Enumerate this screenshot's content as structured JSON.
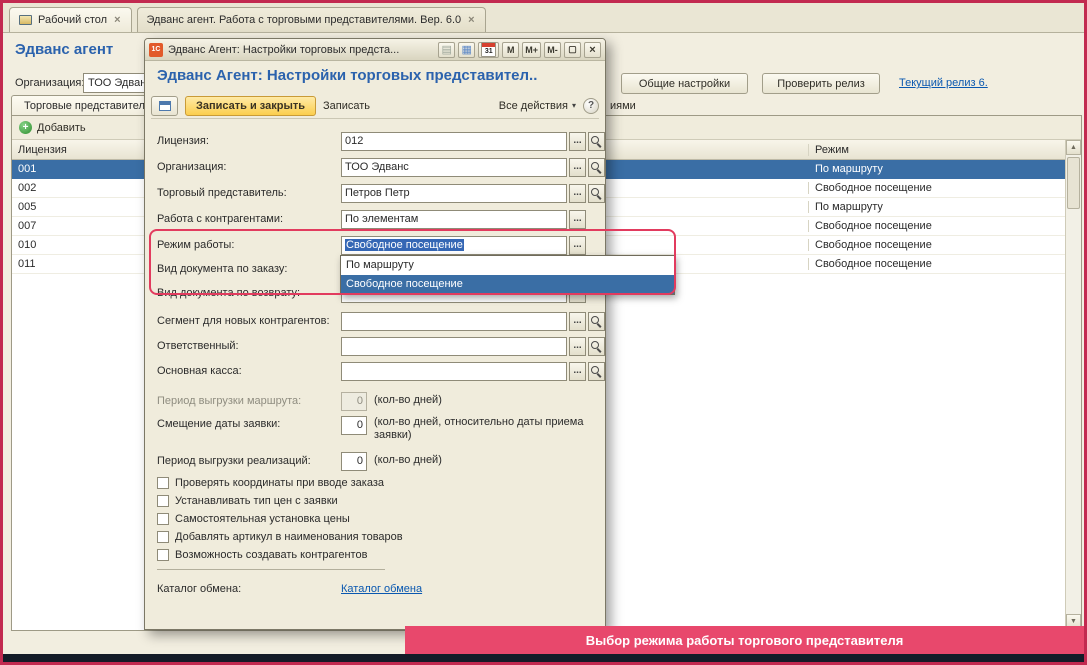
{
  "ui": {
    "close": "×",
    "ellipsis": "...",
    "arrow_down": "▾",
    "scroll_up": "▲",
    "scroll_down": "▼",
    "plus": "+",
    "grid_glyph": "▦",
    "panel_glyph": "▤",
    "maximize_glyph": "▢"
  },
  "colors": {
    "accent_red": "#e23b5e",
    "selection_blue": "#3a6ea5",
    "link_blue": "#0a58b0",
    "banner_pink": "#e8486c"
  },
  "window_tabs": [
    {
      "label": "Рабочий стол"
    },
    {
      "label": "Эдванс агент. Работа с торговыми представителями. Вер. 6.0"
    }
  ],
  "main": {
    "title": "Эдванс агент",
    "org": {
      "label": "Организация:",
      "value": "ТОО Эдванс"
    },
    "actions": {
      "common_settings": "Общие настройки",
      "check_release": "Проверить релиз",
      "current_release": "Текущий релиз 6."
    },
    "tab_reps": "Торговые представители",
    "tab_fragment": "иями",
    "add_button": "Добавить",
    "table": {
      "columns": [
        "Лицензия",
        "Режим"
      ],
      "selected_row": 0,
      "rows": [
        {
          "license": "001",
          "mode": "По маршруту"
        },
        {
          "license": "002",
          "mode": "Свободное посещение"
        },
        {
          "license": "005",
          "mode": "По маршруту"
        },
        {
          "license": "007",
          "mode": "Свободное посещение"
        },
        {
          "license": "010",
          "mode": "Свободное посещение"
        },
        {
          "license": "011",
          "mode": "Свободное посещение"
        }
      ]
    }
  },
  "dialog": {
    "titlebar": {
      "icon": "1С",
      "title": "Эдванс Агент: Настройки торговых предста...",
      "calendar": "31",
      "m": "M",
      "m_plus": "M+",
      "m_minus": "M-"
    },
    "heading": "Эдванс Агент: Настройки торговых представител..",
    "toolbar": {
      "save_close": "Записать и закрыть",
      "save": "Записать",
      "all_actions": "Все действия",
      "help": "?"
    },
    "fields": {
      "license": {
        "label": "Лицензия:",
        "value": "012"
      },
      "organization": {
        "label": "Организация:",
        "value": "ТОО Эдванс"
      },
      "sales_rep": {
        "label": "Торговый представитель:",
        "value": "Петров Петр"
      },
      "counterparties": {
        "label": "Работа с контрагентами:",
        "value": "По элементам"
      },
      "work_mode": {
        "label": "Режим работы:",
        "value": "Свободное посещение"
      },
      "order_doc": {
        "label": "Вид документа по заказу:",
        "value": ""
      },
      "return_doc": {
        "label": "Вид документа по возврату:",
        "value": ""
      },
      "segment": {
        "label": "Сегмент для новых контрагентов:",
        "value": ""
      },
      "responsible": {
        "label": "Ответственный:",
        "value": ""
      },
      "cash": {
        "label": "Основная касса:",
        "value": ""
      },
      "route_period": {
        "label": "Период выгрузки маршрута:",
        "value": "0",
        "hint": "(кол-во дней)"
      },
      "date_offset": {
        "label": "Смещение даты заявки:",
        "value": "0",
        "hint": "(кол-во дней, относительно даты приема заявки)"
      },
      "sales_period": {
        "label": "Период выгрузки реализаций:",
        "value": "0",
        "hint": "(кол-во дней)"
      }
    },
    "checkboxes": [
      "Проверять координаты при вводе заказа",
      "Устанавливать тип цен с заявки",
      "Самостоятельная установка цены",
      "Добавлять артикул в наименования товаров",
      "Возможность создавать контрагентов"
    ],
    "exchange": {
      "label": "Каталог обмена:",
      "link": "Каталог обмена"
    },
    "dropdown": {
      "options": [
        "По маршруту",
        "Свободное посещение"
      ],
      "selected": 1
    }
  },
  "banner": "Выбор режима работы торгового представителя"
}
